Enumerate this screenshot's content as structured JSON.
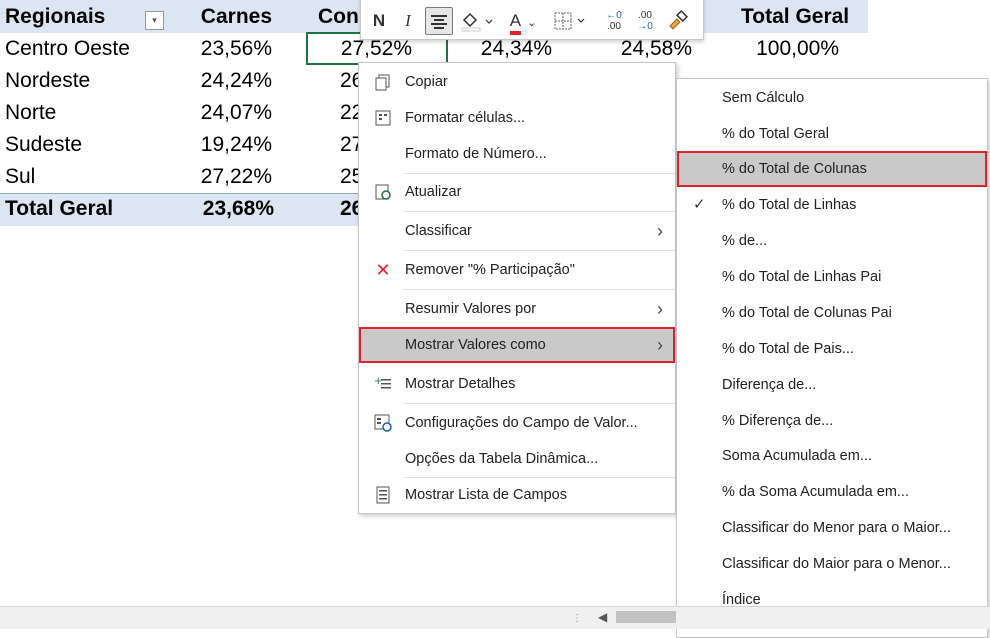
{
  "table": {
    "headers": {
      "region": "Regionais",
      "carnes": "Carnes",
      "con": "Con",
      "total": "Total Geral"
    },
    "filter_icon": "dropdown-filter-icon",
    "rows": [
      {
        "region": "Centro Oeste",
        "carnes": "23,56%",
        "c3": "27,52%",
        "c4": "24,34%",
        "c5": "24,58%",
        "total": "100,00%"
      },
      {
        "region": "Nordeste",
        "carnes": "24,24%",
        "c3": "26"
      },
      {
        "region": "Norte",
        "carnes": "24,07%",
        "c3": "22"
      },
      {
        "region": "Sudeste",
        "carnes": "19,24%",
        "c3": "27"
      },
      {
        "region": "Sul",
        "carnes": "27,22%",
        "c3": "25"
      }
    ],
    "total_row": {
      "region": "Total Geral",
      "carnes": "23,68%",
      "c3": "26"
    }
  },
  "mini_toolbar": {
    "bold": "N",
    "italic": "I",
    "font_color_letter": "A",
    "increase_decimal_top": "←0",
    "increase_decimal_bottom": ".00",
    "decrease_decimal_top": ".00",
    "decrease_decimal_bottom": "→0",
    "accent_red": "#e0222f"
  },
  "context_menu": {
    "items": [
      {
        "label": "Copiar",
        "icon": "copy-icon"
      },
      {
        "label": "Formatar células...",
        "icon": "format-cells-icon"
      },
      {
        "label": "Formato de Número..."
      },
      {
        "label": "Atualizar",
        "icon": "refresh-icon"
      },
      {
        "label": "Classificar",
        "submenu": true
      },
      {
        "label": "Remover \"% Participação\"",
        "icon": "remove-x-icon"
      },
      {
        "label": "Resumir Valores por",
        "submenu": true
      },
      {
        "label": "Mostrar Valores como",
        "submenu": true,
        "active": true
      },
      {
        "label": "Mostrar Detalhes",
        "icon": "show-details-icon"
      },
      {
        "label": "Configurações do Campo de Valor...",
        "icon": "field-settings-icon"
      },
      {
        "label": "Opções da Tabela Dinâmica..."
      },
      {
        "label": "Mostrar Lista de Campos",
        "icon": "field-list-icon"
      }
    ],
    "arrow": "›"
  },
  "submenu": {
    "items": [
      {
        "label": "Sem Cálculo"
      },
      {
        "label": "% do Total Geral"
      },
      {
        "label": "% do Total de Colunas",
        "active": true
      },
      {
        "label": "% do Total de Linhas",
        "checked": true
      },
      {
        "label": "% de..."
      },
      {
        "label": "% do Total de Linhas Pai"
      },
      {
        "label": "% do Total de Colunas Pai"
      },
      {
        "label": "% do Total de Pais..."
      },
      {
        "label": "Diferença de..."
      },
      {
        "label": "% Diferença de..."
      },
      {
        "label": "Soma Acumulada em..."
      },
      {
        "label": "% da Soma Acumulada em..."
      },
      {
        "label": "Classificar do Menor para o Maior..."
      },
      {
        "label": "Classificar do Maior para o Menor..."
      },
      {
        "label": "Índice"
      }
    ],
    "check_mark": "✓"
  },
  "scrollbar": {
    "left_arrow": "◀",
    "grip": "⋮"
  },
  "colors": {
    "header_band": "#dce6f2",
    "highlight": "#c9c9c9",
    "highlight_border": "#e0222f",
    "selection_border": "#1f7244"
  }
}
